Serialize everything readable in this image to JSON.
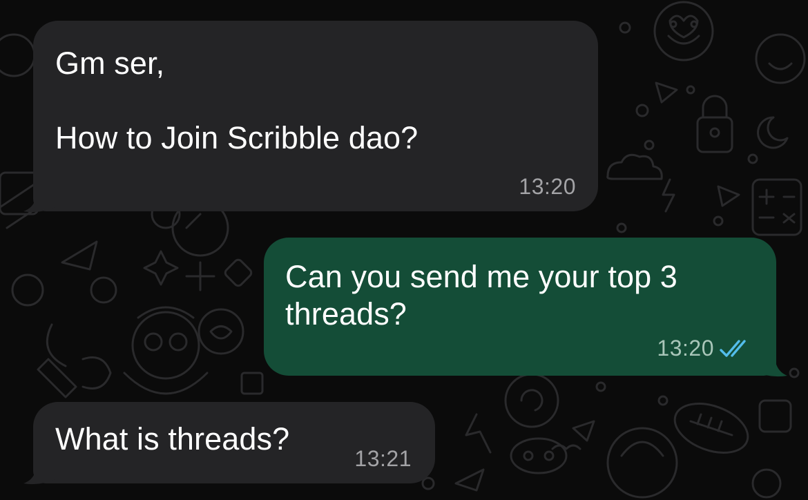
{
  "colors": {
    "background": "#0b0b0b",
    "incoming_bubble": "#242426",
    "outgoing_bubble": "#144d37",
    "timestamp_incoming": "#a3a3a6",
    "timestamp_outgoing": "#a9c6b9",
    "read_receipt": "#53bdeb"
  },
  "messages": [
    {
      "direction": "incoming",
      "text": "Gm ser,\n\nHow to Join Scribble dao?",
      "time": "13:20"
    },
    {
      "direction": "outgoing",
      "text": "Can you send me your top 3\nthreads?",
      "time": "13:20",
      "status_icon": "double-check-icon"
    },
    {
      "direction": "incoming",
      "text": "What is threads?",
      "time": "13:21"
    }
  ]
}
